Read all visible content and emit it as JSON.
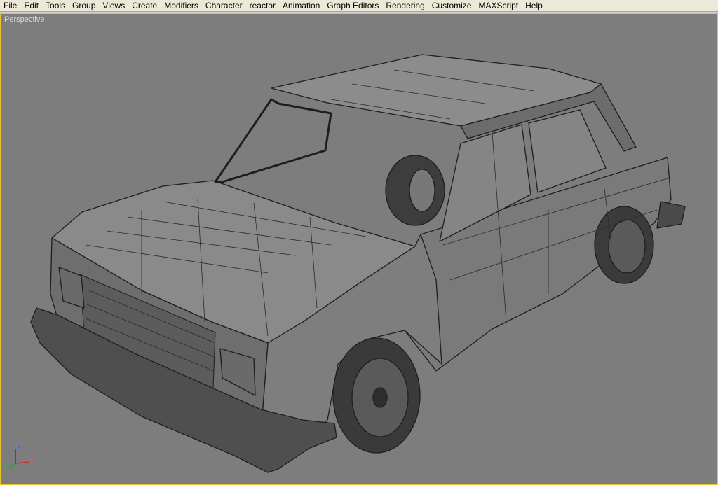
{
  "menu": {
    "items": [
      {
        "label": "File"
      },
      {
        "label": "Edit"
      },
      {
        "label": "Tools"
      },
      {
        "label": "Group"
      },
      {
        "label": "Views"
      },
      {
        "label": "Create"
      },
      {
        "label": "Modifiers"
      },
      {
        "label": "Character"
      },
      {
        "label": "reactor"
      },
      {
        "label": "Animation"
      },
      {
        "label": "Graph Editors"
      },
      {
        "label": "Rendering"
      },
      {
        "label": "Customize"
      },
      {
        "label": "MAXScript"
      },
      {
        "label": "Help"
      }
    ]
  },
  "viewport": {
    "label": "Perspective",
    "active_border_color": "#e9c42c",
    "background_color": "#7d7d7d"
  },
  "axis_gizmo": {
    "x": "x",
    "y": "y",
    "z": "z"
  }
}
